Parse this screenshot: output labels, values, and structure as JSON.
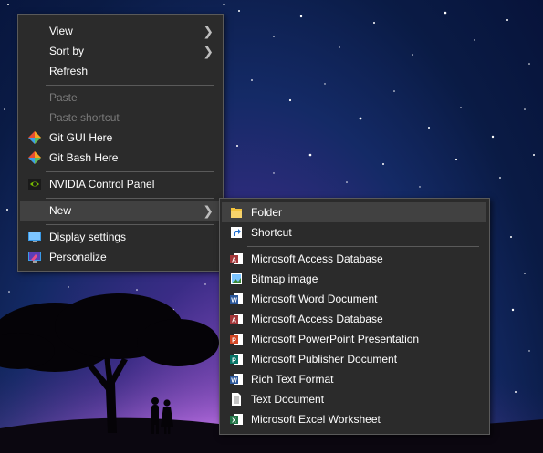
{
  "context_menu": {
    "items": [
      {
        "label": "View",
        "has_submenu": true
      },
      {
        "label": "Sort by",
        "has_submenu": true
      },
      {
        "label": "Refresh"
      },
      {
        "label": "Paste",
        "disabled": true
      },
      {
        "label": "Paste shortcut",
        "disabled": true
      },
      {
        "label": "Git GUI Here",
        "icon": "git-gui-icon"
      },
      {
        "label": "Git Bash Here",
        "icon": "git-bash-icon"
      },
      {
        "label": "NVIDIA Control Panel",
        "icon": "nvidia-icon"
      },
      {
        "label": "New",
        "has_submenu": true,
        "highlighted": true
      },
      {
        "label": "Display settings",
        "icon": "display-settings-icon"
      },
      {
        "label": "Personalize",
        "icon": "personalize-icon"
      }
    ]
  },
  "new_submenu": {
    "items": [
      {
        "label": "Folder",
        "icon": "folder-icon",
        "highlighted": true
      },
      {
        "label": "Shortcut",
        "icon": "shortcut-icon"
      },
      {
        "label": "Microsoft Access Database",
        "icon": "access-icon",
        "color": "#a4373a"
      },
      {
        "label": "Bitmap image",
        "icon": "bitmap-icon"
      },
      {
        "label": "Microsoft Word Document",
        "icon": "word-icon",
        "color": "#2b579a"
      },
      {
        "label": "Microsoft Access Database",
        "icon": "access-icon",
        "color": "#a4373a"
      },
      {
        "label": "Microsoft PowerPoint Presentation",
        "icon": "powerpoint-icon",
        "color": "#d24726"
      },
      {
        "label": "Microsoft Publisher Document",
        "icon": "publisher-icon",
        "color": "#077568"
      },
      {
        "label": "Rich Text Format",
        "icon": "rtf-icon",
        "color": "#2b579a"
      },
      {
        "label": "Text Document",
        "icon": "text-document-icon"
      },
      {
        "label": "Microsoft Excel Worksheet",
        "icon": "excel-icon",
        "color": "#217346"
      }
    ]
  },
  "glyphs": {
    "submenu_arrow": "❯"
  }
}
